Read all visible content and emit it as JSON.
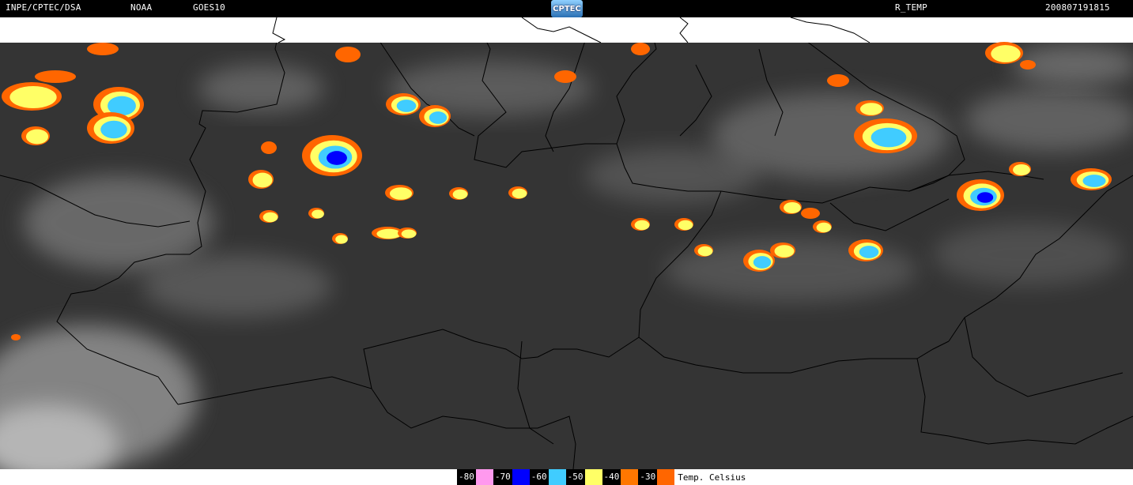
{
  "header": {
    "source": "INPE/CPTEC/DSA",
    "agency": "NOAA",
    "satellite": "GOES10",
    "logo_text": "CPTEC",
    "product": "R_TEMP",
    "timestamp": "200807191815"
  },
  "colors": {
    "background_top": "#ffffff",
    "map_base": "#3a3a3a",
    "clouds": "#8a8a8a",
    "borders": "#000000"
  },
  "legend": {
    "title": "Temp. Celsius",
    "items": [
      {
        "label": "-80",
        "color": "#ff99ee"
      },
      {
        "label": "-70",
        "color": "#0000ff"
      },
      {
        "label": "-60",
        "color": "#40ccff"
      },
      {
        "label": "-50",
        "color": "#ffff66"
      },
      {
        "label": "-40",
        "color": "#ff7700"
      },
      {
        "label": "-30",
        "color": "#ff6600"
      }
    ]
  }
}
